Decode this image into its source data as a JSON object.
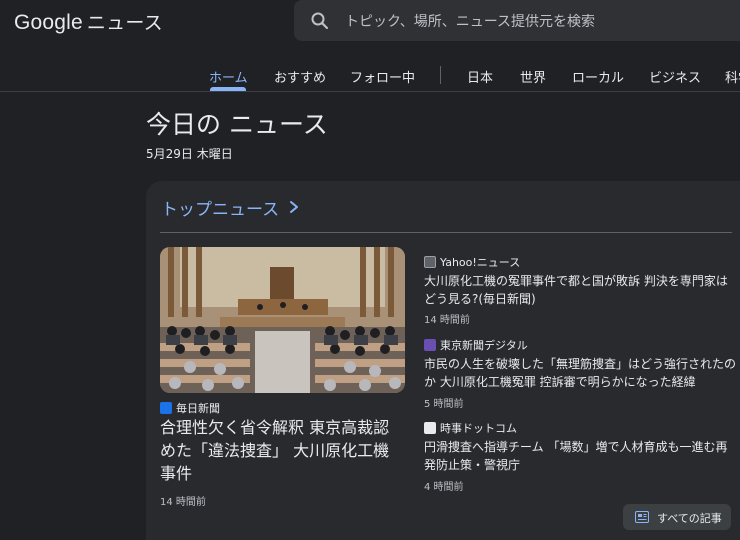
{
  "header": {
    "logo_google": "Google",
    "logo_news": "ニュース",
    "search_placeholder": "トピック、場所、ニュース提供元を検索"
  },
  "nav": {
    "tabs": [
      {
        "label": "ホーム",
        "active": true
      },
      {
        "label": "おすすめ"
      },
      {
        "label": "フォロー中"
      },
      {
        "label": "日本"
      },
      {
        "label": "世界"
      },
      {
        "label": "ローカル"
      },
      {
        "label": "ビジネス"
      },
      {
        "label": "科学"
      }
    ]
  },
  "page": {
    "title": "今日の ニュース",
    "date": "5月29日 木曜日"
  },
  "top_news": {
    "title": "トップニュース",
    "hero": {
      "source": "毎日新聞",
      "headline": "合理性欠く省令解釈 東京高裁認めた「違法捜査」 大川原化工機事件",
      "time": "14 時間前"
    },
    "articles": [
      {
        "source": "Yahoo!ニュース",
        "headline": "大川原化工機の冤罪事件で都と国が敗訴 判決を専門家はどう見る?(毎日新聞)",
        "time": "14 時間前"
      },
      {
        "source": "東京新聞デジタル",
        "headline": "市民の人生を破壊した「無理筋捜査」はどう強行されたのか 大川原化工機冤罪 控訴審で明らかになった経緯",
        "time": "5 時間前"
      },
      {
        "source": "時事ドットコム",
        "headline": "円滑捜査へ指導チーム 「場数」増で人材育成も一進む再発防止策・警視庁",
        "time": "4 時間前"
      }
    ],
    "all_articles_label": "すべての記事"
  },
  "colors": {
    "background": "#202124",
    "card": "#292a2d",
    "accent": "#8ab4f8",
    "text": "#e8eaed",
    "muted": "#bdc1c6"
  },
  "icons": {
    "search": "search-icon",
    "chevron": "chevron-right-icon",
    "all_articles": "all-articles-icon"
  }
}
